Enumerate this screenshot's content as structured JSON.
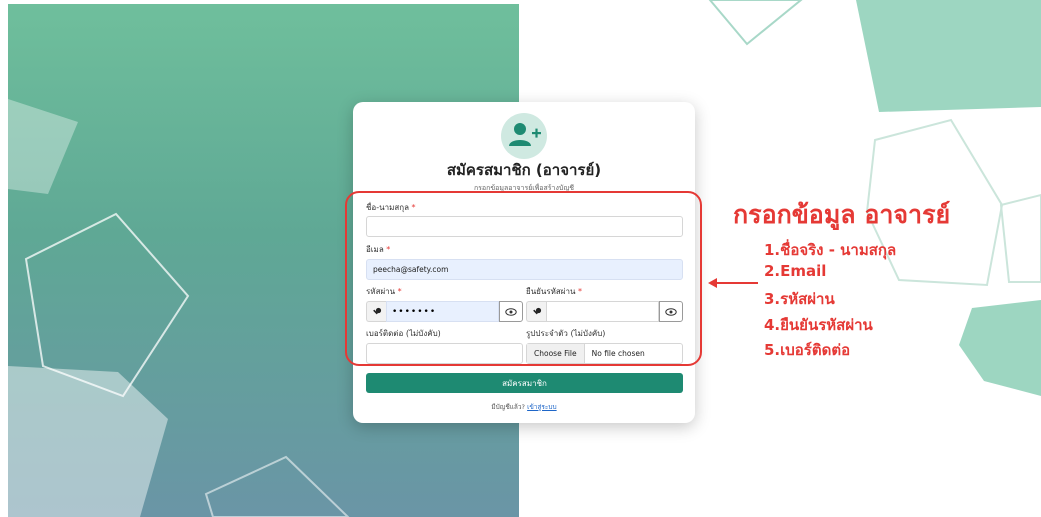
{
  "card": {
    "title": "สมัครสมาชิก (อาจารย์)",
    "subtitle": "กรอกข้อมูลอาจารย์เพื่อสร้างบัญชี",
    "fullname": {
      "label": "ชื่อ-นามสกุล",
      "required_mark": "*",
      "value": "",
      "placeholder": ""
    },
    "email": {
      "label": "อีเมล",
      "required_mark": "*",
      "value": "peecha@safety.com"
    },
    "password": {
      "label": "รหัสผ่าน",
      "required_mark": "*",
      "value": "•••••••"
    },
    "confirm_password": {
      "label": "ยืนยันรหัสผ่าน",
      "required_mark": "*",
      "value": ""
    },
    "phone": {
      "label": "เบอร์ติดต่อ (ไม่บังคับ)",
      "value": ""
    },
    "photo": {
      "label": "รูปประจำตัว (ไม่บังคับ)",
      "button_label": "Choose File",
      "file_status": "No file chosen"
    },
    "submit_label": "สมัครสมาชิก",
    "login_prompt": "มีบัญชีแล้ว?",
    "login_link": "เข้าสู่ระบบ"
  },
  "annotation": {
    "title": "กรอกข้อมูล อาจารย์",
    "items": [
      "1.ชื่อจริง - นามสกุล",
      "2.Email",
      "3.รหัสผ่าน",
      "4.ยืนยันรหัสผ่าน",
      "5.เบอร์ติดต่อ"
    ],
    "color": "#e53935"
  },
  "colors": {
    "accent": "#1e8a72",
    "panel_top": "#6fbf9c",
    "panel_bottom": "#6a95a6"
  },
  "icons": {
    "avatar": "user-plus-icon",
    "password_key": "key-icon",
    "toggle_visibility": "eye-icon"
  }
}
